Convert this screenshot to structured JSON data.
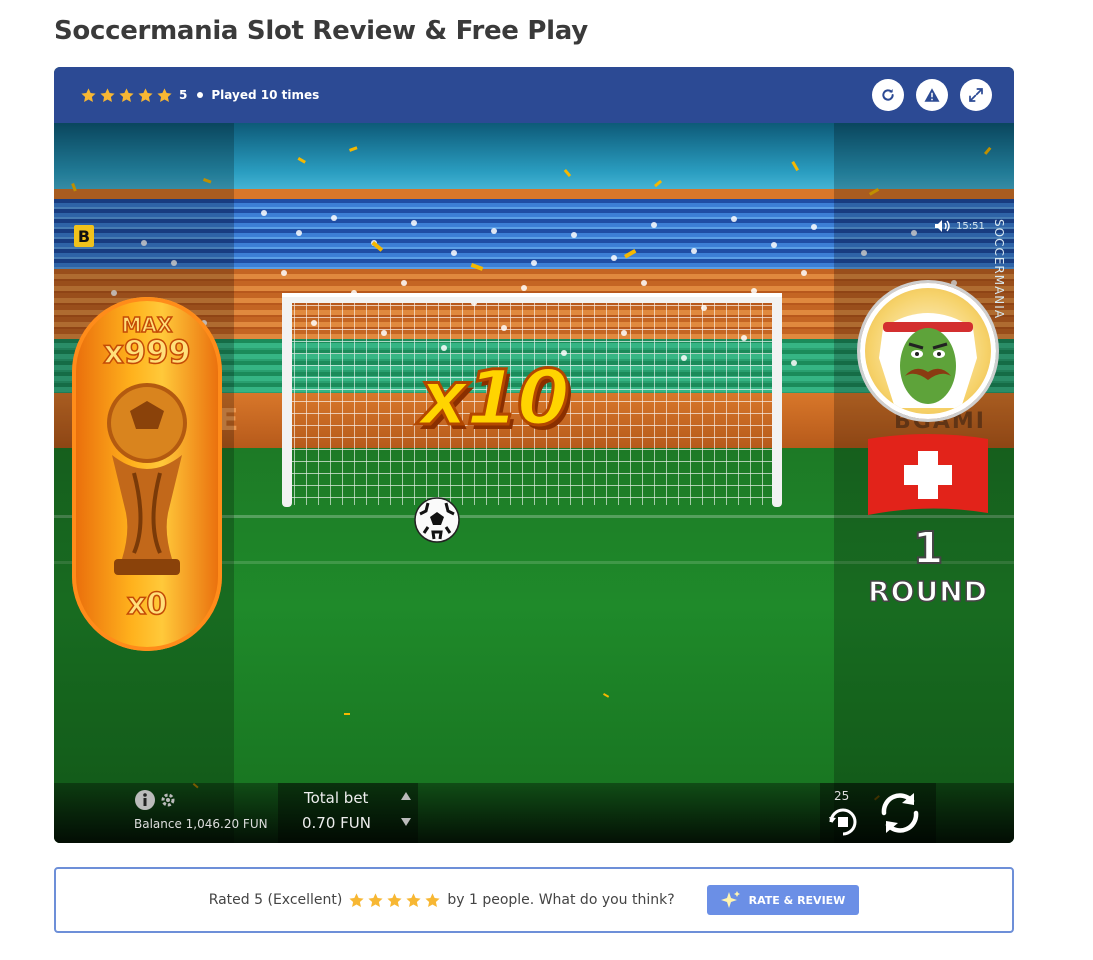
{
  "page": {
    "title": "Soccermania Slot Review & Free Play"
  },
  "game_header": {
    "rating_value": "5",
    "stars_count": 5,
    "played_text": "Played 10 times",
    "buttons": {
      "reload_icon": "reload-icon",
      "report_icon": "warning-icon",
      "fullscreen_icon": "expand-icon"
    }
  },
  "game": {
    "badge_letter": "B",
    "clock": "15:51",
    "game_name_vertical": "SOCCERMANIA",
    "trophy": {
      "max_label": "MAX",
      "max_multiplier": "x999",
      "count": "x0"
    },
    "multiplier": "x10",
    "round": {
      "number": "1",
      "label": "ROUND"
    },
    "ad_board_left": "CE",
    "ad_board_right": "BGAMI",
    "bottom": {
      "balance": "Balance 1,046.20 FUN",
      "total_bet_label": "Total bet",
      "total_bet_value": "0.70 FUN",
      "autoplay_count": "25"
    },
    "colors": {
      "header_blue": "#2c4a94",
      "field_green": "#1f8a2a",
      "gold": "#ffb21d",
      "flag_red": "#e2231a"
    }
  },
  "rating_box": {
    "text_before": "Rated 5 (Excellent)",
    "stars_count": 5,
    "text_after": "by 1 people. What do you think?",
    "button_label": "RATE & REVIEW",
    "button_icon": "sparkle-icon"
  }
}
